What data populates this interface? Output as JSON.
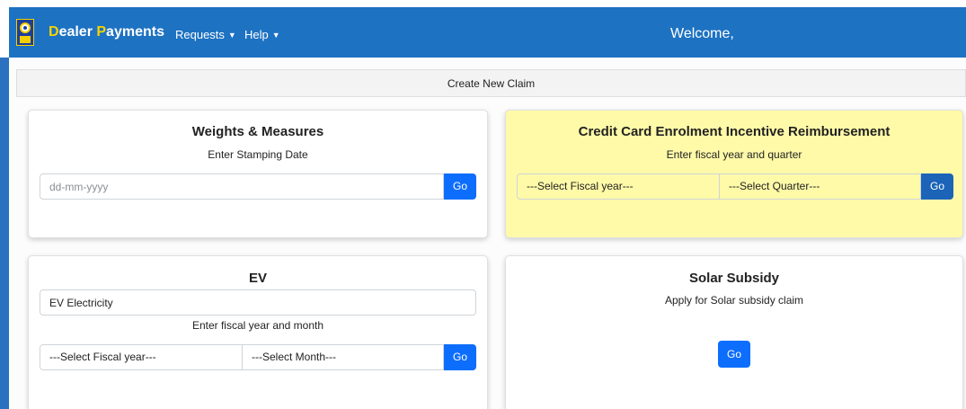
{
  "navbar": {
    "brand_first_letter": "D",
    "brand_first_rest": "ealer ",
    "brand_second_letter": "P",
    "brand_second_rest": "ayments",
    "menus": [
      {
        "label": "Requests"
      },
      {
        "label": "Help"
      }
    ],
    "welcome": "Welcome,"
  },
  "claim": {
    "header": "Create New Claim",
    "weights_measures": {
      "title": "Weights & Measures",
      "subtitle": "Enter Stamping Date",
      "date_placeholder": "dd-mm-yyyy",
      "go_label": "Go"
    },
    "credit_card": {
      "title": "Credit Card Enrolment Incentive Reimbursement",
      "subtitle": "Enter fiscal year and quarter",
      "fiscal_year_select": "---Select Fiscal year---",
      "quarter_select": "---Select Quarter---",
      "go_label": "Go",
      "highlight_color": "#fffaa8"
    },
    "ev": {
      "title": "EV",
      "type_value": "EV Electricity",
      "subtitle": "Enter fiscal year and month",
      "fiscal_year_select": "---Select Fiscal year---",
      "month_select": "---Select Month---",
      "go_label": "Go"
    },
    "solar": {
      "title": "Solar Subsidy",
      "subtitle": "Apply for Solar subsidy claim",
      "go_label": "Go"
    }
  },
  "colors": {
    "navbar": "#1d72c2",
    "button": "#0d6efd",
    "brand_highlight": "#f6d300"
  }
}
